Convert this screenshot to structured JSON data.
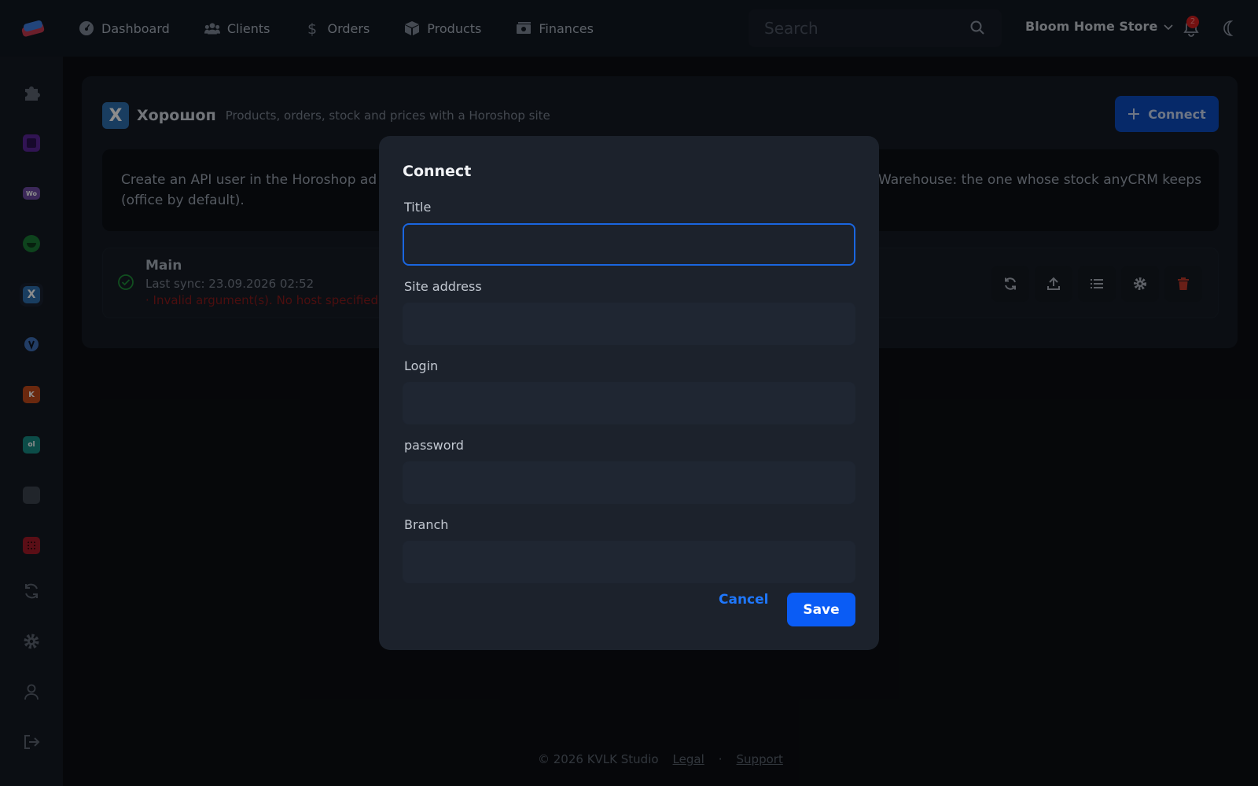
{
  "nav": {
    "items": [
      {
        "label": "Dashboard",
        "icon": "gauge-icon"
      },
      {
        "label": "Clients",
        "icon": "users-icon"
      },
      {
        "label": "Orders",
        "icon": "dollar-icon"
      },
      {
        "label": "Products",
        "icon": "box-icon"
      },
      {
        "label": "Finances",
        "icon": "money-icon"
      }
    ]
  },
  "search": {
    "placeholder": "Search"
  },
  "store": {
    "name": "Bloom Home Store"
  },
  "notifications": {
    "count": "2"
  },
  "sidebar": {
    "items": [
      {
        "name": "integrations",
        "icon": "puzzle-icon"
      },
      {
        "name": "app-purple",
        "icon": "app-tile-icon",
        "color": "#6a2fb0"
      },
      {
        "name": "woocommerce",
        "icon": "woo-icon",
        "color": "#7f54b3",
        "text": "Wo"
      },
      {
        "name": "app-green",
        "icon": "app-tile-icon",
        "color": "#1f8f3a"
      },
      {
        "name": "horoshop",
        "icon": "horoshop-icon",
        "color": "#2f6fb0",
        "text": "X"
      },
      {
        "name": "app-shield",
        "icon": "shield-icon",
        "color": "#4a7fd0"
      },
      {
        "name": "app-orange",
        "icon": "app-tile-icon",
        "color": "#d9531e",
        "text": "K"
      },
      {
        "name": "app-teal",
        "icon": "app-tile-icon",
        "color": "#1aa39a",
        "text": "ol"
      },
      {
        "name": "app-gray",
        "icon": "app-tile-icon",
        "color": "#4a5260"
      },
      {
        "name": "app-red",
        "icon": "app-tile-icon",
        "color": "#c21f2f"
      },
      {
        "name": "sync",
        "icon": "sync-icon"
      },
      {
        "name": "settings",
        "icon": "gear-icon"
      },
      {
        "name": "profile",
        "icon": "user-icon"
      },
      {
        "name": "logout",
        "icon": "logout-icon"
      }
    ]
  },
  "integration": {
    "logo_letter": "X",
    "title": "Хорошоп",
    "subtitle": "Products, orders, stock and prices with a Horoshop site",
    "connect_label": "Connect",
    "info_text": "Create an API user in the Horoshop admin, enter its credentials and the site address. Warehouse: the one whose stock anyCRM keeps (office by default).",
    "info_visible_left": "Create an API user in the Horoshop ad",
    "info_visible_right": "Warehouse: the one whose stock anyCRM keeps",
    "info_line2": "(office by default)."
  },
  "connection": {
    "name": "Main",
    "last_sync": "Last sync: 23.09.2026 02:52",
    "error": "· Invalid argument(s). No host specified i"
  },
  "modal": {
    "title": "Connect",
    "fields": [
      {
        "label": "Title",
        "value": ""
      },
      {
        "label": "Site address",
        "value": ""
      },
      {
        "label": "Login",
        "value": ""
      },
      {
        "label": "password",
        "value": ""
      },
      {
        "label": "Branch",
        "value": ""
      }
    ],
    "cancel_label": "Cancel",
    "save_label": "Save"
  },
  "footer": {
    "copyright": "© 2026 KVLK Studio",
    "legal": "Legal",
    "separator": "·",
    "support": "Support"
  },
  "colors": {
    "accent": "#0a5cf5",
    "background": "#0b0e13",
    "surface": "#151b24",
    "error": "#8a1c1c",
    "success": "#1f8f3a"
  }
}
